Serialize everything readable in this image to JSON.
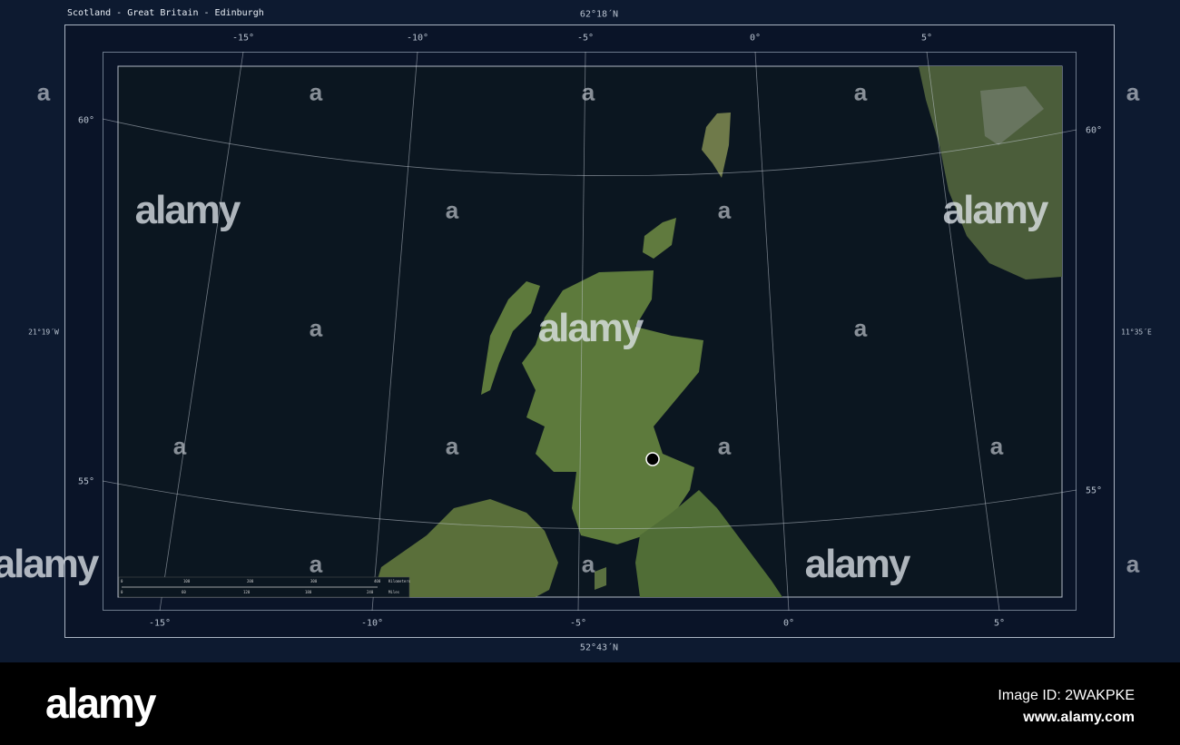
{
  "title": "Scotland - Great Britain - Edinburgh",
  "frame_labels": {
    "top": "62°18´N",
    "bottom": "52°43´N",
    "left": "21°19´W",
    "right": "11°35´E"
  },
  "lon_labels": [
    "-15°",
    "-10°",
    "-5°",
    "0°",
    "5°"
  ],
  "lat_labels": [
    "60°",
    "55°"
  ],
  "scale_bar": {
    "km_ticks": [
      "0",
      "100",
      "200",
      "300",
      "400"
    ],
    "km_unit": "Kilometers",
    "mi_ticks": [
      "0",
      "60",
      "120",
      "180",
      "240"
    ],
    "mi_unit": "Miles"
  },
  "marker": {
    "city": "Edinburgh",
    "color": "#000000"
  },
  "watermark": {
    "text": "alamy",
    "glyph": "a"
  },
  "footer": {
    "logo": "alamy",
    "image_id": "Image ID: 2WAKPKE",
    "url": "www.alamy.com"
  },
  "colors": {
    "ocean": "#0b1620",
    "land": "#5d7a3c",
    "frame_bg": "#0d1a30"
  }
}
